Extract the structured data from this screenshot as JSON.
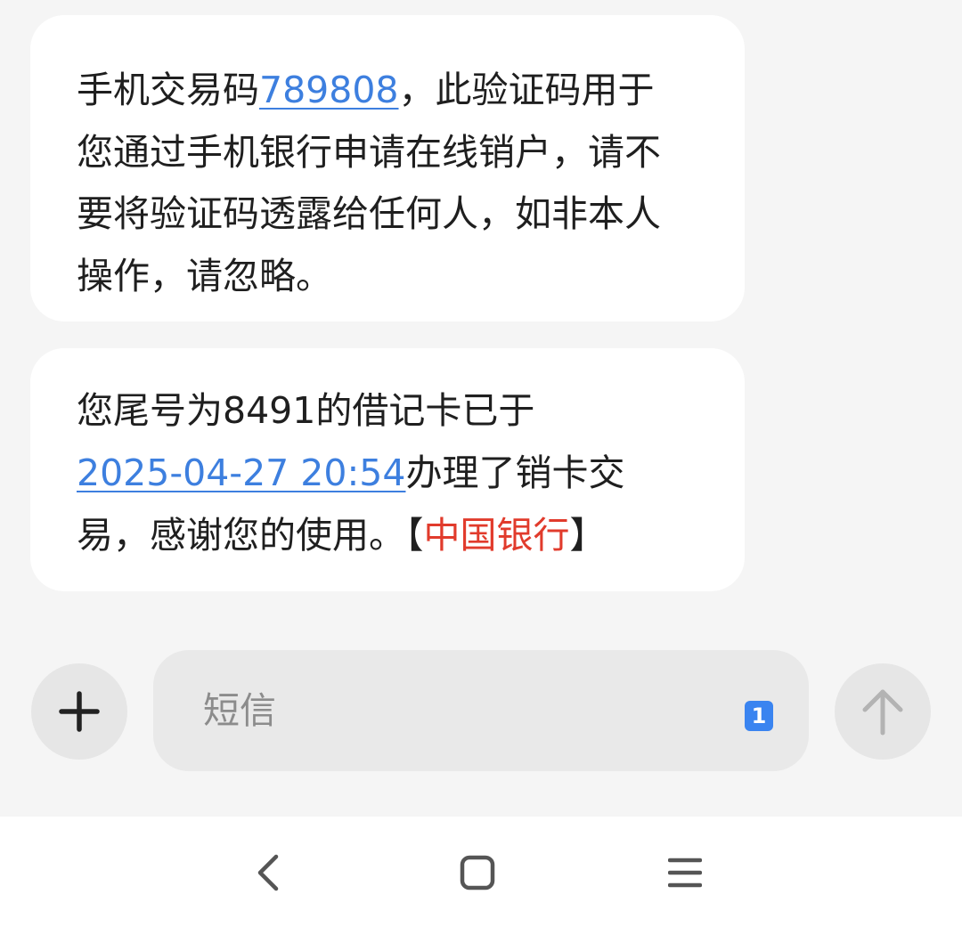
{
  "messages": [
    {
      "lines": [
        {
          "pre": "手机交易码",
          "link": "789808",
          "post": "，此验证码用于"
        },
        {
          "text": "您通过手机银行申请在线销户，请不"
        },
        {
          "text": "要将验证码透露给任何人，如非本人"
        },
        {
          "text": "操作，请忽略。"
        }
      ]
    },
    {
      "line1": "您尾号为8491的借记卡已于",
      "link": "2025-04-27 20:54",
      "line2_post": "办理了销卡交",
      "line3_pre": "易，感谢您的使用。【",
      "bank": "中国银行",
      "line3_post": "】"
    }
  ],
  "input": {
    "placeholder": "短信",
    "sim_badge": "1"
  },
  "icons": {
    "add": "plus-icon",
    "send": "arrow-up-icon",
    "back": "chevron-left-icon",
    "home": "square-icon",
    "menu": "menu-icon"
  },
  "colors": {
    "link": "#3d7fdf",
    "bank": "#e13b2c",
    "badge": "#3a84f0"
  }
}
